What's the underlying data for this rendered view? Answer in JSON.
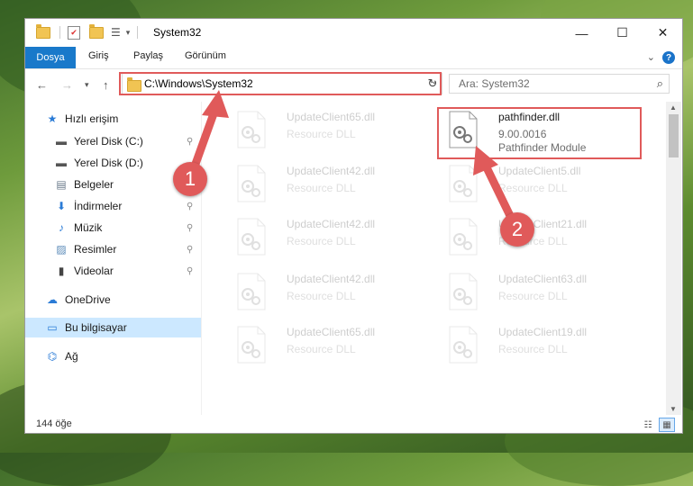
{
  "window": {
    "title": "System32",
    "controls": {
      "minimize": "—",
      "maximize": "☐",
      "close": "✕"
    }
  },
  "ribbon": {
    "tabs": [
      "Dosya",
      "Giriş",
      "Paylaş",
      "Görünüm"
    ],
    "help": "?"
  },
  "navigation": {
    "address": "C:\\Windows\\System32",
    "search_placeholder": "Ara: System32"
  },
  "sidebar": {
    "items": [
      {
        "label": "Hızlı erişim",
        "icon": "star-icon",
        "pinned": false
      },
      {
        "label": "Yerel Disk (C:)",
        "icon": "drive-icon",
        "pinned": true
      },
      {
        "label": "Yerel Disk (D:)",
        "icon": "drive-icon",
        "pinned": false
      },
      {
        "label": "Belgeler",
        "icon": "documents-icon",
        "pinned": true
      },
      {
        "label": "İndirmeler",
        "icon": "download-icon",
        "pinned": true
      },
      {
        "label": "Müzik",
        "icon": "music-icon",
        "pinned": true
      },
      {
        "label": "Resimler",
        "icon": "pictures-icon",
        "pinned": true
      },
      {
        "label": "Videolar",
        "icon": "videos-icon",
        "pinned": true
      },
      {
        "label": "OneDrive",
        "icon": "cloud-icon",
        "pinned": false
      },
      {
        "label": "Bu bilgisayar",
        "icon": "computer-icon",
        "pinned": false,
        "selected": true
      },
      {
        "label": "Ağ",
        "icon": "network-icon",
        "pinned": false
      }
    ]
  },
  "files": [
    {
      "name": "UpdateClient65.dll",
      "desc": "Resource DLL",
      "faded": true
    },
    {
      "name": "pathfinder.dll",
      "version": "9.00.0016",
      "desc": "Pathfinder Module",
      "faded": false,
      "highlighted": true
    },
    {
      "name": "UpdateClient42.dll",
      "desc": "Resource DLL",
      "faded": true
    },
    {
      "name": "UpdateClient5.dll",
      "desc": "Resource DLL",
      "faded": true
    },
    {
      "name": "UpdateClient42.dll",
      "desc": "Resource DLL",
      "faded": true
    },
    {
      "name": "UpdateClient21.dll",
      "desc": "Resource DLL",
      "faded": true
    },
    {
      "name": "UpdateClient42.dll",
      "desc": "Resource DLL",
      "faded": true
    },
    {
      "name": "UpdateClient63.dll",
      "desc": "Resource DLL",
      "faded": true
    },
    {
      "name": "UpdateClient65.dll",
      "desc": "Resource DLL",
      "faded": true
    },
    {
      "name": "UpdateClient19.dll",
      "desc": "Resource DLL",
      "faded": true
    }
  ],
  "status": {
    "count": "144 öğe"
  },
  "annotations": {
    "step1": "1",
    "step2": "2",
    "color": "#e05a5a"
  }
}
